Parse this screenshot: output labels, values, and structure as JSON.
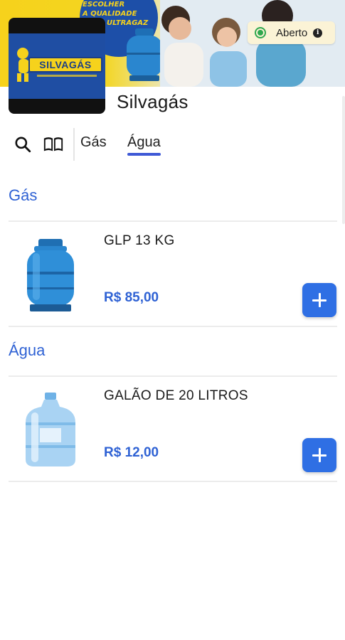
{
  "banner": {
    "promo_line1": "ESCOLHER",
    "promo_line2": "A QUALIDADE",
    "promo_line3": "ULTRAGAZ",
    "colors": {
      "yellow": "#f6d21c",
      "blue": "#1d4fa8"
    }
  },
  "status": {
    "label": "Aberto",
    "icon": "info-icon",
    "dot_color": "#2fa84f"
  },
  "store": {
    "name": "Silvagás",
    "logo_text": "SILVAGÁS"
  },
  "category_bar": {
    "search_icon": "search-icon",
    "menu_icon": "menu-book-icon",
    "tabs": [
      {
        "label": "Gás",
        "active": false
      },
      {
        "label": "Água",
        "active": true
      }
    ]
  },
  "sections": [
    {
      "title": "Gás",
      "products": [
        {
          "name": "GLP 13 KG",
          "price": "R$ 85,00",
          "image_icon": "gas-cylinder-icon"
        }
      ]
    },
    {
      "title": "Água",
      "products": [
        {
          "name": "GALÃO DE 20 LITROS",
          "price": "R$ 12,00",
          "image_icon": "water-jug-icon"
        }
      ]
    }
  ],
  "colors": {
    "accent": "#2f62d4",
    "button": "#2f6fe4",
    "tab_underline": "#3e59d6"
  }
}
